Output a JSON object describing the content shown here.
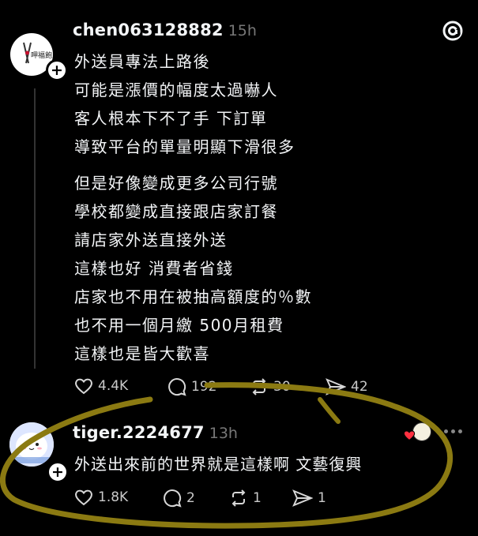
{
  "post1": {
    "username": "chen063128882",
    "time": "15h",
    "avatar_text": "呷福飽",
    "lines": [
      "外送員專法上路後",
      "可能是漲價的幅度太過嚇人",
      "客人根本下不了手 下訂單",
      "導致平台的單量明顯下滑很多",
      "",
      "但是好像變成更多公司行號",
      "學校都變成直接跟店家訂餐",
      "請店家外送直接外送",
      "這樣也好 消費者省錢",
      "店家也不用在被抽高額度的％數",
      "也不用一個月繳 500月租費",
      "這樣也是皆大歡喜"
    ],
    "likes": "4.4K",
    "comments": "192",
    "reposts": "30",
    "shares": "42"
  },
  "post2": {
    "username": "tiger.2224677",
    "time": "13h",
    "text": "外送出來前的世界就是這樣啊 文藝復興",
    "likes": "1.8K",
    "comments": "2",
    "reposts": "1",
    "shares": "1"
  },
  "colors": {
    "background": "#000000",
    "text": "#f3f5f7",
    "muted": "#777777",
    "annotation": "#8b7a12",
    "like_heart": "#ff3040"
  },
  "icons": [
    "threads-logo-icon",
    "heart-icon",
    "comment-icon",
    "repost-icon",
    "share-icon",
    "more-icon"
  ]
}
